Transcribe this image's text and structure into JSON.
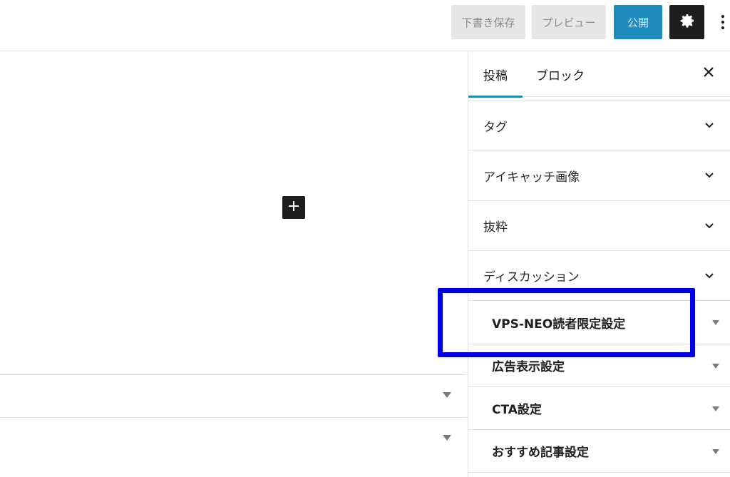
{
  "toolbar": {
    "draft_label": "下書き保存",
    "preview_label": "プレビュー",
    "publish_label": "公開",
    "settings_icon": "gear-icon",
    "more_icon": "more-vertical-icon",
    "publish_color": "#1e8cbe",
    "settings_bg": "#1e1e1e"
  },
  "canvas": {
    "inserter_icon": "plus-icon"
  },
  "sidebar": {
    "tabs": [
      {
        "label": "投稿",
        "active": true
      },
      {
        "label": "ブロック",
        "active": false
      }
    ],
    "close_icon": "close-icon",
    "panels": [
      {
        "label": "タグ",
        "icon": "chevron-down-icon"
      },
      {
        "label": "アイキャッチ画像",
        "icon": "chevron-down-icon"
      },
      {
        "label": "抜粋",
        "icon": "chevron-down-icon"
      },
      {
        "label": "ディスカッション",
        "icon": "chevron-down-icon"
      }
    ],
    "meta_boxes": [
      {
        "label": "VPS-NEO読者限定設定",
        "icon": "triangle-down-icon",
        "highlighted": true
      },
      {
        "label": "広告表示設定",
        "icon": "triangle-down-icon"
      },
      {
        "label": "CTA設定",
        "icon": "triangle-down-icon"
      },
      {
        "label": "おすすめ記事設定",
        "icon": "triangle-down-icon"
      }
    ]
  },
  "colors": {
    "highlight_border": "#0000e6",
    "accent": "#1e8cbe"
  }
}
